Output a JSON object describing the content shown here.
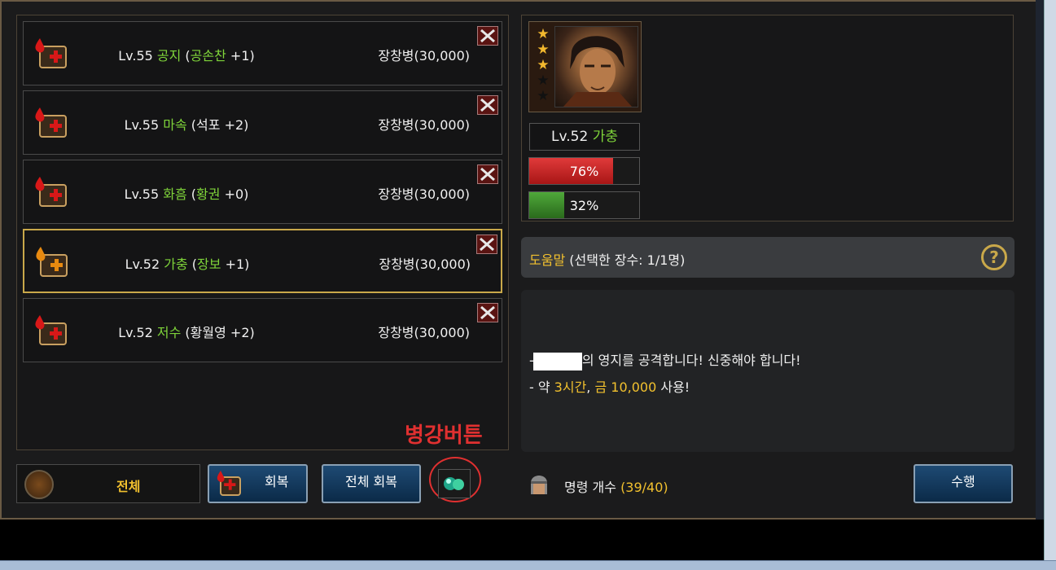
{
  "rows": [
    {
      "lv": "Lv.55 ",
      "general": "공지",
      "open": " (",
      "sub": "공손찬",
      "plus": " +1)",
      "sub_green": true,
      "troop": "장창병(30,000)",
      "selected": false,
      "icon_color": "red"
    },
    {
      "lv": "Lv.55 ",
      "general": "마속",
      "open": " (",
      "sub": "석포",
      "plus": " +2)",
      "sub_green": false,
      "troop": "장창병(30,000)",
      "selected": false,
      "icon_color": "red"
    },
    {
      "lv": "Lv.55 ",
      "general": "화흠",
      "open": " (",
      "sub": "황권",
      "plus": " +0)",
      "sub_green": true,
      "troop": "장창병(30,000)",
      "selected": false,
      "icon_color": "red"
    },
    {
      "lv": "Lv.52 ",
      "general": "가충",
      "open": " (",
      "sub": "장보",
      "plus": " +1)",
      "sub_green": true,
      "troop": "장창병(30,000)",
      "selected": true,
      "icon_color": "orange"
    },
    {
      "lv": "Lv.52 ",
      "general": "저수",
      "open": " (",
      "sub": "황월영",
      "plus": " +2)",
      "sub_green": false,
      "troop": "장창병(30,000)",
      "selected": false,
      "icon_color": "red"
    }
  ],
  "annotation": "병강버튼",
  "bottom": {
    "all_label": "전체",
    "recover_label": "회복",
    "recover_all_label": "전체 회복",
    "command_label": "명령 개수 ",
    "command_count": "(39/40)",
    "execute_label": "수행"
  },
  "portrait": {
    "stars_filled": 3,
    "stars_total": 5,
    "level": "Lv.52 ",
    "name": "가충",
    "hp_pct": 76,
    "hp_text": "76%",
    "morale_pct": 32,
    "morale_text": "32%"
  },
  "help": {
    "title": "도움말",
    "detail": " (선택한 장수: 1/1명)",
    "icon": "question-icon"
  },
  "info": {
    "line1_prefix": "- ",
    "line1_text": "의 영지를 공격합니다! 신중해야 합니다!",
    "line2_a": "- 약 ",
    "line2_time": "3시간",
    "line2_b": ", ",
    "line2_gold": "금 10,000",
    "line2_c": " 사용!"
  },
  "colors": {
    "accent_green": "#7fd43a",
    "accent_yellow": "#f2c12e",
    "annotation_red": "#e03030"
  }
}
